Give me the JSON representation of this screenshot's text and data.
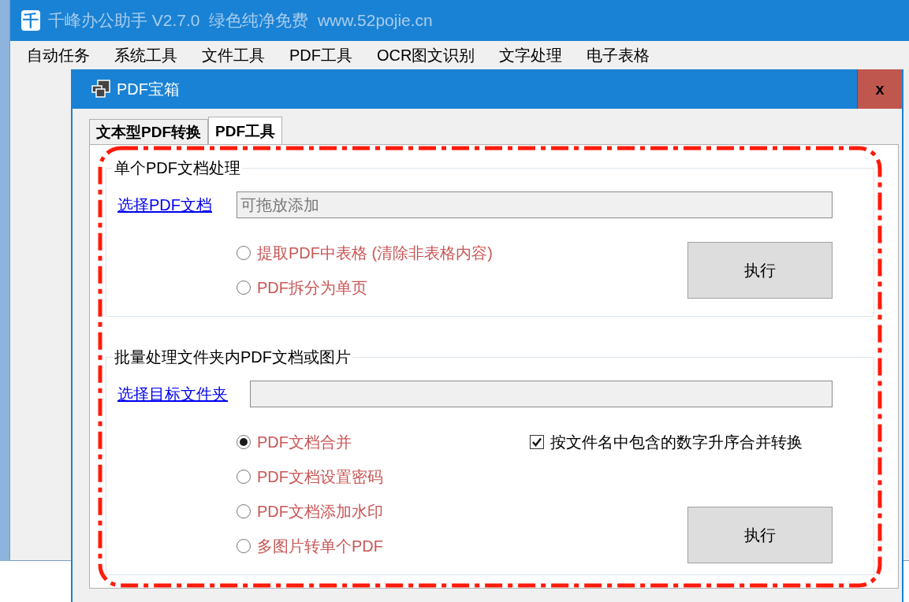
{
  "main_window": {
    "logo": "千",
    "title": "千峰办公助手 V2.7.0  绿色纯净免费  www.52pojie.cn",
    "menu": [
      "自动任务",
      "系统工具",
      "文件工具",
      "PDF工具",
      "OCR图文识别",
      "文字处理",
      "电子表格"
    ]
  },
  "dialog": {
    "title": "PDF宝箱",
    "close": "x",
    "tabs": [
      {
        "label": "文本型PDF转换",
        "selected": false
      },
      {
        "label": "PDF工具",
        "selected": true
      }
    ],
    "groups": [
      {
        "title": "单个PDF文档处理",
        "link": "选择PDF文档",
        "field": {
          "placeholder": "可拖放添加"
        },
        "options": [
          {
            "label": "提取PDF中表格 (清除非表格内容)",
            "selected": false
          },
          {
            "label": "PDF拆分为单页",
            "selected": false
          }
        ],
        "button": "执行"
      },
      {
        "title": "批量处理文件夹内PDF文档或图片",
        "link": "选择目标文件夹",
        "options": [
          {
            "label": "PDF文档合并",
            "selected": true
          },
          {
            "label": "PDF文档设置密码",
            "selected": false
          },
          {
            "label": "PDF文档添加水印",
            "selected": false
          },
          {
            "label": "多图片转单个PDF",
            "selected": false
          }
        ],
        "checkbox": {
          "label": "按文件名中包含的数字升序合并转换",
          "checked": true
        },
        "button": "执行"
      }
    ]
  }
}
